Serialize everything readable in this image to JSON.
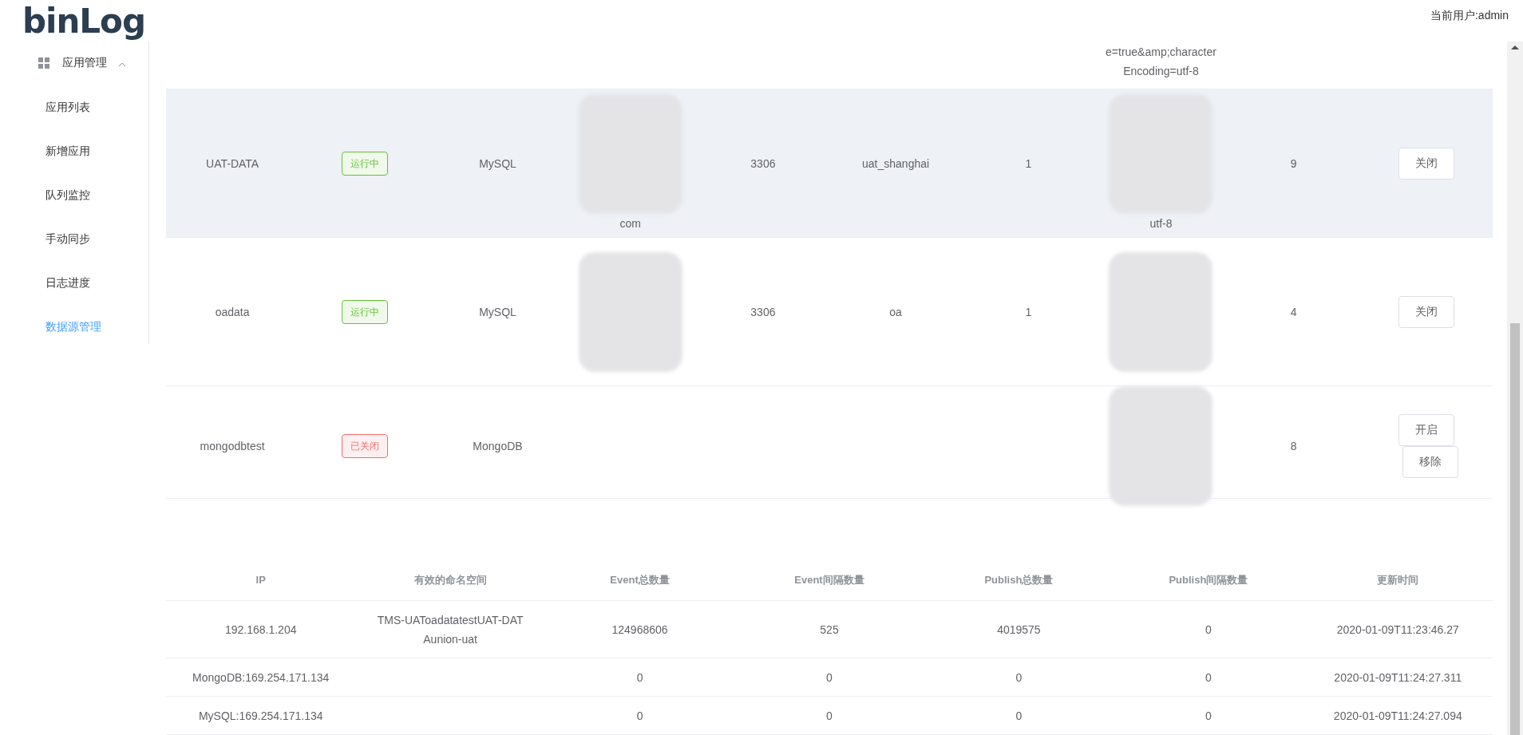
{
  "header": {
    "logo": "binLog",
    "user": "当前用户:admin"
  },
  "sidebar": {
    "group": {
      "label": "应用管理",
      "expanded": true
    },
    "items": [
      {
        "label": "应用列表",
        "selected": false
      },
      {
        "label": "新增应用",
        "selected": false
      },
      {
        "label": "队列监控",
        "selected": false
      },
      {
        "label": "手动同步",
        "selected": false
      },
      {
        "label": "日志进度",
        "selected": false
      },
      {
        "label": "数据源管理",
        "selected": true
      }
    ]
  },
  "datasource_table": {
    "rows": [
      {
        "highlighted": false,
        "cells": [
          {
            "kind": "empty"
          },
          {
            "kind": "empty"
          },
          {
            "kind": "empty"
          },
          {
            "kind": "empty"
          },
          {
            "kind": "empty"
          },
          {
            "kind": "empty"
          },
          {
            "kind": "empty"
          },
          {
            "kind": "text",
            "lines": [
              "e=true&amp;character",
              "Encoding=utf-8"
            ]
          },
          {
            "kind": "empty"
          },
          {
            "kind": "empty"
          }
        ]
      },
      {
        "highlighted": true,
        "cells": [
          {
            "kind": "text",
            "lines": [
              "UAT-DATA"
            ]
          },
          {
            "kind": "tag",
            "label": "运行中",
            "color": "#67c23a"
          },
          {
            "kind": "text",
            "lines": [
              "MySQL"
            ]
          },
          {
            "kind": "redacted",
            "lines": [
              "com"
            ]
          },
          {
            "kind": "text",
            "lines": [
              "3306"
            ]
          },
          {
            "kind": "text",
            "lines": [
              "uat_shanghai"
            ]
          },
          {
            "kind": "text",
            "lines": [
              "1"
            ]
          },
          {
            "kind": "redacted",
            "lines": [
              "utf-8"
            ]
          },
          {
            "kind": "text",
            "lines": [
              "9"
            ]
          },
          {
            "kind": "buttons",
            "buttons": [
              "关闭"
            ]
          }
        ]
      },
      {
        "highlighted": false,
        "cells": [
          {
            "kind": "text",
            "lines": [
              "oadata"
            ]
          },
          {
            "kind": "tag",
            "label": "运行中",
            "color": "#67c23a"
          },
          {
            "kind": "text",
            "lines": [
              "MySQL"
            ]
          },
          {
            "kind": "redacted"
          },
          {
            "kind": "text",
            "lines": [
              "3306"
            ]
          },
          {
            "kind": "text",
            "lines": [
              "oa"
            ]
          },
          {
            "kind": "text",
            "lines": [
              "1"
            ]
          },
          {
            "kind": "redacted"
          },
          {
            "kind": "text",
            "lines": [
              "4"
            ]
          },
          {
            "kind": "buttons",
            "buttons": [
              "关闭"
            ]
          }
        ]
      },
      {
        "highlighted": false,
        "cells": [
          {
            "kind": "text",
            "lines": [
              "mongodbtest"
            ]
          },
          {
            "kind": "tag",
            "label": "已关闭",
            "color": "#f56c6c"
          },
          {
            "kind": "text",
            "lines": [
              "MongoDB"
            ]
          },
          {
            "kind": "empty"
          },
          {
            "kind": "empty"
          },
          {
            "kind": "empty"
          },
          {
            "kind": "empty"
          },
          {
            "kind": "redacted"
          },
          {
            "kind": "text",
            "lines": [
              "8"
            ]
          },
          {
            "kind": "buttons",
            "buttons": [
              "开启",
              "移除"
            ]
          }
        ]
      }
    ]
  },
  "stats_table": {
    "columns": [
      "IP",
      "有效的命名空间",
      "Event总数量",
      "Event间隔数量",
      "Publish总数量",
      "Publish间隔数量",
      "更新时间"
    ],
    "rows": [
      [
        "192.168.1.204",
        "TMS-UAToadatatestUAT-DATAunion-uat",
        "124968606",
        "525",
        "4019575",
        "0",
        "2020-01-09T11:23:46.27"
      ],
      [
        "MongoDB:169.254.171.134",
        "",
        "0",
        "0",
        "0",
        "0",
        "2020-01-09T11:24:27.311"
      ],
      [
        "MySQL:169.254.171.134",
        "",
        "0",
        "0",
        "0",
        "0",
        "2020-01-09T11:24:27.094"
      ]
    ]
  }
}
